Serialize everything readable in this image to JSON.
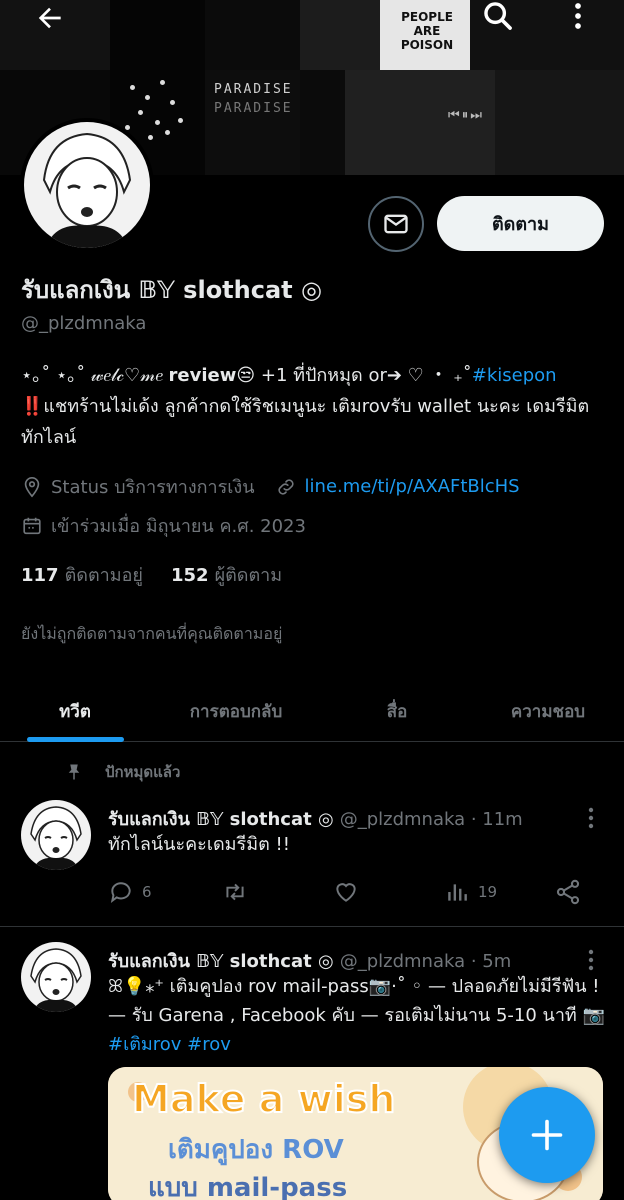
{
  "banner": {
    "paradise_line1": "PARADISE",
    "paradise_line2": "PARADISE",
    "people_line1": "PEOPLE",
    "people_line2": "ARE",
    "people_line3": "POISON",
    "media_controls": "⏮⏸⏭"
  },
  "header": {
    "back_icon": "arrow-left-icon",
    "search_icon": "search-icon",
    "more_icon": "more-vertical-icon"
  },
  "profile": {
    "display_name": "รับแลกเงิน 𝔹𝕐 slothcat ◎",
    "handle": "@_plzdmnaka",
    "message_icon": "envelope-icon",
    "follow_label": "ติดตาม",
    "bio_line1_prefix": "⋆｡˚ ⋆｡˚ 𝓌𝑒𝓁𝒸♡𝓂𝑒",
    "bio_line1_bold": "review",
    "bio_line1_rest": "😒 +1 ที่ปักหมุด or➔ ♡ ・ ₊˚",
    "bio_hashtag": "#kisepon",
    "bio_line2": "‼️แชทร้านไม่เด้ง ลูกค้ากดใช้ริชเมนูนะ เติมrovรับ wallet นะคะ เดมรีมิตทักไลน์",
    "category": "Status บริการทางการเงิน",
    "link": "line.me/ti/p/AXAFtBlcHS",
    "joined": "เข้าร่วมเมื่อ มิถุนายน ค.ศ. 2023",
    "following_count": "117",
    "following_label": "ติดตามอยู่",
    "followers_count": "152",
    "followers_label": "ผู้ติดตาม",
    "not_followed_note": "ยังไม่ถูกติดตามจากคนที่คุณติดตามอยู่"
  },
  "tabs": [
    {
      "label": "ทวีต",
      "active": true
    },
    {
      "label": "การตอบกลับ",
      "active": false
    },
    {
      "label": "สื่อ",
      "active": false
    },
    {
      "label": "ความชอบ",
      "active": false
    }
  ],
  "pinned_label": "ปักหมุดแล้ว",
  "tweets": [
    {
      "name": "รับแลกเงิน 𝔹𝕐 slothcat ◎",
      "handle_time": "@_plzdmnaka · 11m",
      "text": "ทักไลน์นะคะเดมรีมิต !!",
      "replies": "6",
      "retweets": "",
      "likes": "",
      "views": "19"
    },
    {
      "name": "รับแลกเงิน 𝔹𝕐 slothcat ◎",
      "handle_time": "@_plzdmnaka · 5m",
      "text_main": "ꕤ💡⁎⁺ เติมคูปอง rov mail-pass📷·˚ ◦ — ปลอดภัยไม่มีรีฟัน ! — รับ Garena , Facebook คับ — รอเติมไม่นาน 5-10 นาที 📷",
      "hashtags": "#เติมrov #rov",
      "image_text1": "Make a wish",
      "image_text2": "เติมคูปอง ROV",
      "image_text3": "แบบ mail-pass"
    }
  ],
  "fab_icon": "plus-icon",
  "colors": {
    "accent": "#1d9bf0",
    "background": "#000000",
    "secondary_text": "#71767b",
    "divider": "#2f3336"
  }
}
